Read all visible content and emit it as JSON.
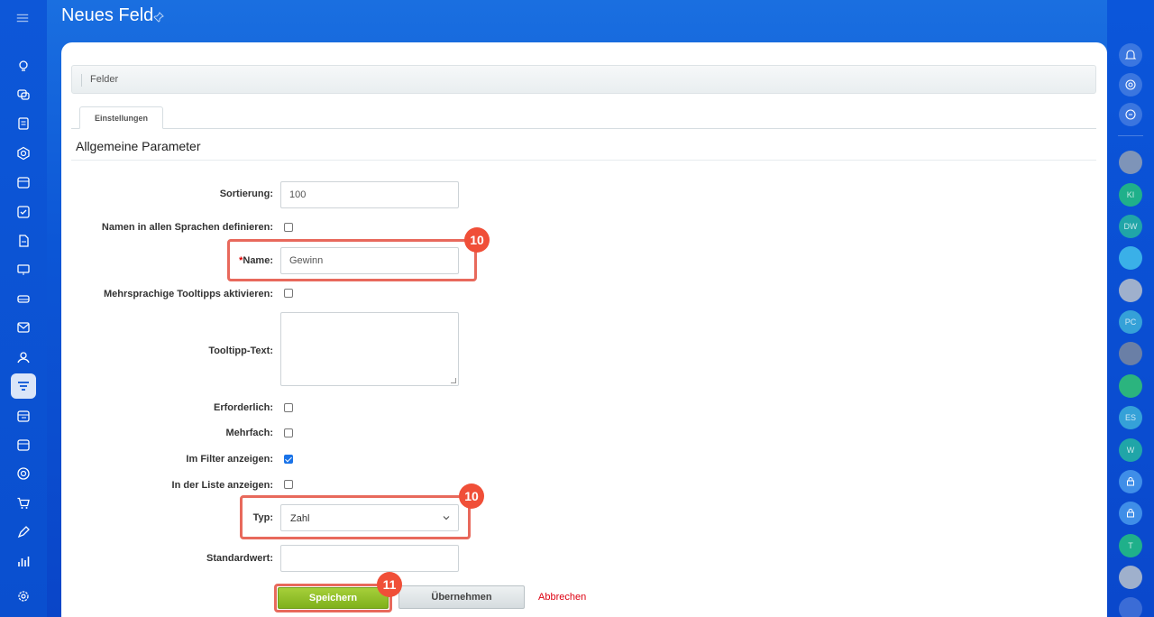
{
  "header": {
    "title": "Neues Feld"
  },
  "breadcrumb": {
    "label": "Felder"
  },
  "tabs": [
    {
      "label": "Einstellungen"
    }
  ],
  "section": {
    "title": "Allgemeine Parameter"
  },
  "form": {
    "sort_label": "Sortierung:",
    "sort_value": "100",
    "names_all_langs_label": "Namen in allen Sprachen definieren:",
    "name_required_mark": "*",
    "name_label": "Name:",
    "name_value": "Gewinn",
    "multilang_tooltips_label": "Mehrsprachige Tooltipps aktivieren:",
    "tooltip_text_label": "Tooltipp-Text:",
    "required_label": "Erforderlich:",
    "multiple_label": "Mehrfach:",
    "show_in_filter_label": "Im Filter anzeigen:",
    "show_in_list_label": "In der Liste anzeigen:",
    "type_label": "Typ:",
    "type_value": "Zahl",
    "default_label": "Standardwert:"
  },
  "checkboxes": {
    "names_all_langs": false,
    "multilang_tooltips": false,
    "required": false,
    "multiple": false,
    "show_in_filter": true,
    "show_in_list": false
  },
  "annotations": {
    "name_badge": "10",
    "type_badge": "10",
    "save_badge": "11"
  },
  "buttons": {
    "save": "Speichern",
    "apply": "Übernehmen",
    "cancel": "Abbrechen"
  },
  "right_sidebar": {
    "avatars": [
      "KI",
      "DW",
      "PC",
      "ES",
      "W",
      "T"
    ]
  },
  "colors": {
    "accent": "#0c56d6",
    "save_green": "#8dbf24",
    "highlight": "#e8695c",
    "badge": "#f04f38"
  }
}
